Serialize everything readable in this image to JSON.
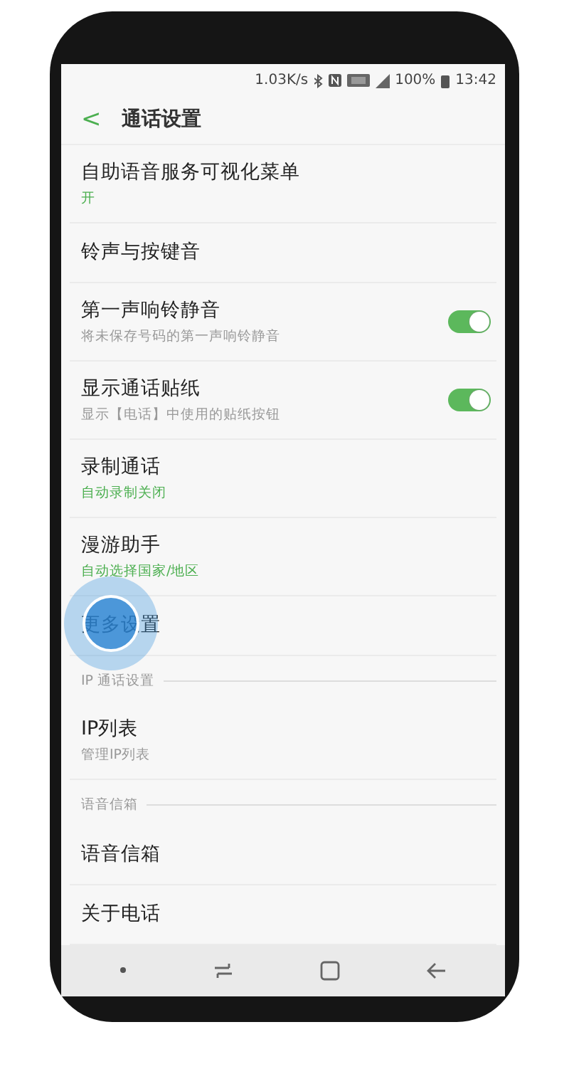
{
  "status_bar": {
    "speed": "1.03K/s",
    "battery": "100%",
    "time": "13:42"
  },
  "header": {
    "back": "<",
    "title": "通话设置"
  },
  "items": [
    {
      "kind": "item",
      "title": "自助语音服务可视化菜单",
      "subtitle": {
        "text": "开",
        "kind": "value"
      }
    },
    {
      "kind": "item",
      "title": "铃声与按键音"
    },
    {
      "kind": "item",
      "title": "第一声响铃静音",
      "subtitle": {
        "text": "将未保存号码的第一声响铃静音",
        "kind": "description"
      },
      "toggle": {
        "on": true
      }
    },
    {
      "kind": "item",
      "title": "显示通话贴纸",
      "subtitle": {
        "text": "显示【电话】中使用的贴纸按钮",
        "kind": "description"
      },
      "toggle": {
        "on": true
      }
    },
    {
      "kind": "item",
      "title": "录制通话",
      "subtitle": {
        "text": "自动录制关闭",
        "kind": "value"
      }
    },
    {
      "kind": "item",
      "title": "漫游助手",
      "subtitle": {
        "text": "自动选择国家/地区",
        "kind": "value"
      }
    },
    {
      "kind": "item",
      "title": "更多设置",
      "pressed": true
    },
    {
      "kind": "header",
      "title": "IP 通话设置"
    },
    {
      "kind": "item",
      "title": "IP列表",
      "subtitle": {
        "text": "管理IP列表",
        "kind": "description"
      }
    },
    {
      "kind": "header",
      "title": "语音信箱"
    },
    {
      "kind": "item",
      "title": "语音信箱"
    },
    {
      "kind": "item",
      "title": "关于电话"
    }
  ]
}
